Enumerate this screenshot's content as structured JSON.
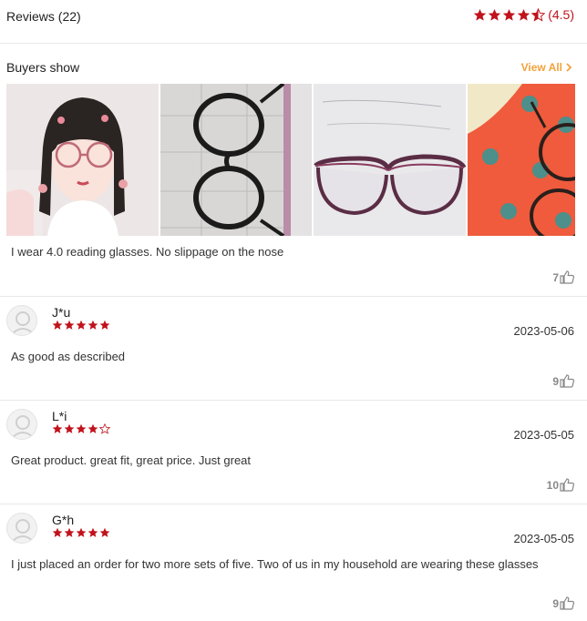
{
  "header": {
    "reviews_label": "Reviews (22)",
    "rating_value": 4.5,
    "rating_text": "(4.5)",
    "accent_color": "#c0131c"
  },
  "buyers_show": {
    "title": "Buyers show",
    "view_all_label": "View All",
    "view_all_color": "#f4a13a",
    "photos": [
      {
        "name": "photo-woman-with-glasses"
      },
      {
        "name": "photo-glasses-on-calendar"
      },
      {
        "name": "photo-purple-glasses"
      },
      {
        "name": "photo-glasses-on-red-cloth"
      }
    ]
  },
  "first_review_fragment": {
    "text": "I wear 4.0 reading glasses. No slippage on the nose",
    "likes": "7"
  },
  "reviews": [
    {
      "name": "J*u",
      "stars": 5,
      "date": "2023-05-06",
      "text": "As good as described",
      "likes": "9"
    },
    {
      "name": "L*i",
      "stars": 4,
      "date": "2023-05-05",
      "text": "Great product. great fit, great price. Just great",
      "likes": "10"
    },
    {
      "name": "G*h",
      "stars": 5,
      "date": "2023-05-05",
      "text": "I just placed an order for two more sets of five. Two of us in my household are wearing these glasses",
      "likes": "9"
    }
  ]
}
